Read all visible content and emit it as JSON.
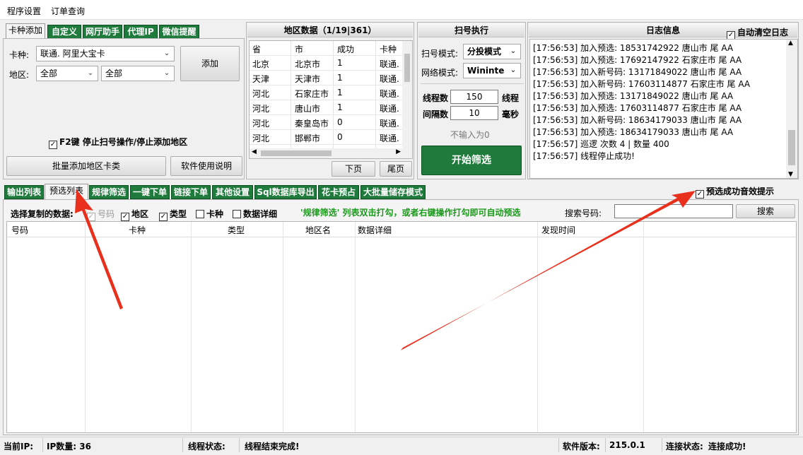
{
  "menu": {
    "settings": "程序设置",
    "orders": "订单查询"
  },
  "top_tabs": [
    "卡种添加",
    "自定义",
    "网厅助手",
    "代理IP",
    "微信提醒"
  ],
  "card_add": {
    "card_label": "卡种:",
    "card_value": "联通. 阿里大宝卡",
    "region_label": "地区:",
    "region1": "全部",
    "region2": "全部",
    "add_button": "添加",
    "f2_text": "F2键 停止扫号操作/停止添加地区",
    "batch_button": "批量添加地区卡类",
    "manual_button": "软件使用说明"
  },
  "region_panel": {
    "title": "地区数据（1/19|361）",
    "headers": [
      "省",
      "市",
      "成功",
      "卡种"
    ],
    "rows": [
      [
        "北京",
        "北京市",
        "1",
        "联通."
      ],
      [
        "天津",
        "天津市",
        "1",
        "联通."
      ],
      [
        "河北",
        "石家庄市",
        "1",
        "联通."
      ],
      [
        "河北",
        "唐山市",
        "1",
        "联通."
      ],
      [
        "河北",
        "秦皇岛市",
        "0",
        "联通."
      ],
      [
        "河北",
        "邯郸市",
        "0",
        "联通."
      ]
    ],
    "next_button": "下页",
    "last_button": "尾页"
  },
  "scan_panel": {
    "title": "扫号执行",
    "mode_label": "扫号模式:",
    "mode_value": "分投模式",
    "net_label": "网络模式:",
    "net_value": "Wininte",
    "threads_label": "线程数",
    "threads_value": "150",
    "threads_unit": "线程",
    "interval_label": "间隔数",
    "interval_value": "10",
    "interval_unit": "毫秒",
    "hint": "不输入为0",
    "start_button": "开始筛选"
  },
  "log_panel": {
    "title": "日志信息",
    "auto_clear": "自动清空日志",
    "lines": [
      "[17:56:53] 加入预选: 18531742922 唐山市 尾 AA",
      "[17:56:53] 加入预选: 17692147922 石家庄市 尾 AA",
      "[17:56:53] 加入新号码: 13171849022 唐山市 尾 AA",
      "[17:56:53] 加入新号码: 17603114877 石家庄市 尾 AA",
      "[17:56:53] 加入预选: 13171849022 唐山市 尾 AA",
      "[17:56:53] 加入预选: 17603114877 石家庄市 尾 AA",
      "[17:56:53] 加入新号码: 18634179033 唐山市 尾 AA",
      "[17:56:53] 加入预选: 18634179033 唐山市 尾 AA",
      "[17:56:57] 巡逻 次数 4 | 数量 400",
      "[17:56:57] 线程停止成功!"
    ]
  },
  "bottom_tabs": [
    "输出列表",
    "预选列表",
    "规律筛选",
    "一键下单",
    "链接下单",
    "其他设置",
    "Sql数据库导出",
    "花卡预占",
    "大批量储存模式"
  ],
  "sound_hint": "预选成功音效提示",
  "filter_bar": {
    "select_label": "选择复制的数据:",
    "opt_number": "号码",
    "opt_region": "地区",
    "opt_type": "类型",
    "opt_card": "卡种",
    "opt_detail": "数据详细",
    "green_hint": "'规律筛选' 列表双击打勾，或者右键操作打勾即可自动预选",
    "search_label": "搜索号码:",
    "search_button": "搜索"
  },
  "table_headers": [
    "号码",
    "卡种",
    "类型",
    "地区名",
    "数据详细",
    "发现时间"
  ],
  "status": {
    "ip_label": "当前IP:",
    "ip_count": "IP数量: 36",
    "thread_label": "线程状态:",
    "thread_value": "线程结束完成!",
    "version_label": "软件版本:",
    "version_value": "215.0.1",
    "conn_label": "连接状态:",
    "conn_value": "连接成功!"
  },
  "colors": {
    "green": "#1e7b3c",
    "hint_green": "#1a9a1a",
    "arrow": "#e8301c"
  }
}
